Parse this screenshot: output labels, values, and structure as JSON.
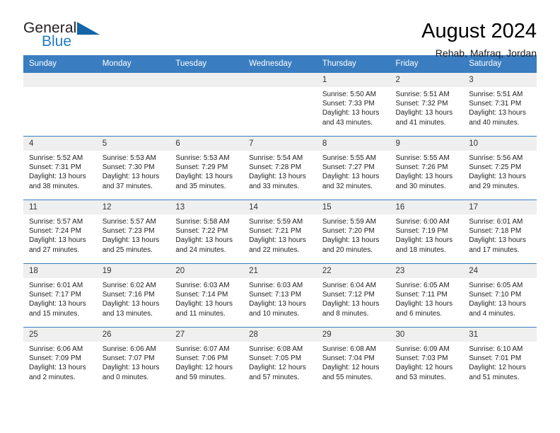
{
  "brand": {
    "name_part1": "General",
    "name_part2": "Blue",
    "accent_color": "#1f7cc4",
    "triangle_color": "#1565a8"
  },
  "header": {
    "title": "August 2024",
    "subtitle": "Rehab, Mafraq, Jordan"
  },
  "calendar": {
    "header_bg": "#3a7dc0",
    "daynum_bg": "#efefef",
    "weekday_headers": [
      "Sunday",
      "Monday",
      "Tuesday",
      "Wednesday",
      "Thursday",
      "Friday",
      "Saturday"
    ],
    "weeks": [
      [
        {
          "day": "",
          "sunrise": "",
          "sunset": "",
          "daylight": "",
          "empty": true
        },
        {
          "day": "",
          "sunrise": "",
          "sunset": "",
          "daylight": "",
          "empty": true
        },
        {
          "day": "",
          "sunrise": "",
          "sunset": "",
          "daylight": "",
          "empty": true
        },
        {
          "day": "",
          "sunrise": "",
          "sunset": "",
          "daylight": "",
          "empty": true
        },
        {
          "day": "1",
          "sunrise": "Sunrise: 5:50 AM",
          "sunset": "Sunset: 7:33 PM",
          "daylight": "Daylight: 13 hours and 43 minutes."
        },
        {
          "day": "2",
          "sunrise": "Sunrise: 5:51 AM",
          "sunset": "Sunset: 7:32 PM",
          "daylight": "Daylight: 13 hours and 41 minutes."
        },
        {
          "day": "3",
          "sunrise": "Sunrise: 5:51 AM",
          "sunset": "Sunset: 7:31 PM",
          "daylight": "Daylight: 13 hours and 40 minutes."
        }
      ],
      [
        {
          "day": "4",
          "sunrise": "Sunrise: 5:52 AM",
          "sunset": "Sunset: 7:31 PM",
          "daylight": "Daylight: 13 hours and 38 minutes."
        },
        {
          "day": "5",
          "sunrise": "Sunrise: 5:53 AM",
          "sunset": "Sunset: 7:30 PM",
          "daylight": "Daylight: 13 hours and 37 minutes."
        },
        {
          "day": "6",
          "sunrise": "Sunrise: 5:53 AM",
          "sunset": "Sunset: 7:29 PM",
          "daylight": "Daylight: 13 hours and 35 minutes."
        },
        {
          "day": "7",
          "sunrise": "Sunrise: 5:54 AM",
          "sunset": "Sunset: 7:28 PM",
          "daylight": "Daylight: 13 hours and 33 minutes."
        },
        {
          "day": "8",
          "sunrise": "Sunrise: 5:55 AM",
          "sunset": "Sunset: 7:27 PM",
          "daylight": "Daylight: 13 hours and 32 minutes."
        },
        {
          "day": "9",
          "sunrise": "Sunrise: 5:55 AM",
          "sunset": "Sunset: 7:26 PM",
          "daylight": "Daylight: 13 hours and 30 minutes."
        },
        {
          "day": "10",
          "sunrise": "Sunrise: 5:56 AM",
          "sunset": "Sunset: 7:25 PM",
          "daylight": "Daylight: 13 hours and 29 minutes."
        }
      ],
      [
        {
          "day": "11",
          "sunrise": "Sunrise: 5:57 AM",
          "sunset": "Sunset: 7:24 PM",
          "daylight": "Daylight: 13 hours and 27 minutes."
        },
        {
          "day": "12",
          "sunrise": "Sunrise: 5:57 AM",
          "sunset": "Sunset: 7:23 PM",
          "daylight": "Daylight: 13 hours and 25 minutes."
        },
        {
          "day": "13",
          "sunrise": "Sunrise: 5:58 AM",
          "sunset": "Sunset: 7:22 PM",
          "daylight": "Daylight: 13 hours and 24 minutes."
        },
        {
          "day": "14",
          "sunrise": "Sunrise: 5:59 AM",
          "sunset": "Sunset: 7:21 PM",
          "daylight": "Daylight: 13 hours and 22 minutes."
        },
        {
          "day": "15",
          "sunrise": "Sunrise: 5:59 AM",
          "sunset": "Sunset: 7:20 PM",
          "daylight": "Daylight: 13 hours and 20 minutes."
        },
        {
          "day": "16",
          "sunrise": "Sunrise: 6:00 AM",
          "sunset": "Sunset: 7:19 PM",
          "daylight": "Daylight: 13 hours and 18 minutes."
        },
        {
          "day": "17",
          "sunrise": "Sunrise: 6:01 AM",
          "sunset": "Sunset: 7:18 PM",
          "daylight": "Daylight: 13 hours and 17 minutes."
        }
      ],
      [
        {
          "day": "18",
          "sunrise": "Sunrise: 6:01 AM",
          "sunset": "Sunset: 7:17 PM",
          "daylight": "Daylight: 13 hours and 15 minutes."
        },
        {
          "day": "19",
          "sunrise": "Sunrise: 6:02 AM",
          "sunset": "Sunset: 7:16 PM",
          "daylight": "Daylight: 13 hours and 13 minutes."
        },
        {
          "day": "20",
          "sunrise": "Sunrise: 6:03 AM",
          "sunset": "Sunset: 7:14 PM",
          "daylight": "Daylight: 13 hours and 11 minutes."
        },
        {
          "day": "21",
          "sunrise": "Sunrise: 6:03 AM",
          "sunset": "Sunset: 7:13 PM",
          "daylight": "Daylight: 13 hours and 10 minutes."
        },
        {
          "day": "22",
          "sunrise": "Sunrise: 6:04 AM",
          "sunset": "Sunset: 7:12 PM",
          "daylight": "Daylight: 13 hours and 8 minutes."
        },
        {
          "day": "23",
          "sunrise": "Sunrise: 6:05 AM",
          "sunset": "Sunset: 7:11 PM",
          "daylight": "Daylight: 13 hours and 6 minutes."
        },
        {
          "day": "24",
          "sunrise": "Sunrise: 6:05 AM",
          "sunset": "Sunset: 7:10 PM",
          "daylight": "Daylight: 13 hours and 4 minutes."
        }
      ],
      [
        {
          "day": "25",
          "sunrise": "Sunrise: 6:06 AM",
          "sunset": "Sunset: 7:09 PM",
          "daylight": "Daylight: 13 hours and 2 minutes."
        },
        {
          "day": "26",
          "sunrise": "Sunrise: 6:06 AM",
          "sunset": "Sunset: 7:07 PM",
          "daylight": "Daylight: 13 hours and 0 minutes."
        },
        {
          "day": "27",
          "sunrise": "Sunrise: 6:07 AM",
          "sunset": "Sunset: 7:06 PM",
          "daylight": "Daylight: 12 hours and 59 minutes."
        },
        {
          "day": "28",
          "sunrise": "Sunrise: 6:08 AM",
          "sunset": "Sunset: 7:05 PM",
          "daylight": "Daylight: 12 hours and 57 minutes."
        },
        {
          "day": "29",
          "sunrise": "Sunrise: 6:08 AM",
          "sunset": "Sunset: 7:04 PM",
          "daylight": "Daylight: 12 hours and 55 minutes."
        },
        {
          "day": "30",
          "sunrise": "Sunrise: 6:09 AM",
          "sunset": "Sunset: 7:03 PM",
          "daylight": "Daylight: 12 hours and 53 minutes."
        },
        {
          "day": "31",
          "sunrise": "Sunrise: 6:10 AM",
          "sunset": "Sunset: 7:01 PM",
          "daylight": "Daylight: 12 hours and 51 minutes."
        }
      ]
    ]
  }
}
